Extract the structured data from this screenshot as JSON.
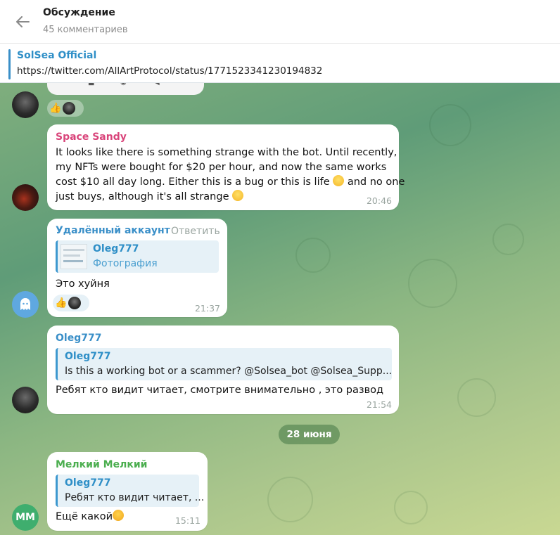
{
  "header": {
    "title": "Обсуждение",
    "subtitle": "45 комментариев"
  },
  "pinned": {
    "name": "SolSea Official",
    "link": "https://twitter.com/AllArtProtocol/status/1771523341230194832"
  },
  "messages": [
    {
      "sender": "Space Sandy",
      "sender_color": "#d9447a",
      "lines": [
        "It looks like there is something strange with the bot. Until recently,",
        "my NFTs were bought for $20 per hour, and now the same works",
        "cost $10 all day long. Either this is a bug or this is life",
        "just buys, although it's all strange"
      ],
      "line3_suffix": "and no one",
      "time": "20:46"
    },
    {
      "sender": "Удалённый аккаунт",
      "sender_color": "#3a8fc8",
      "reply_label": "Ответить",
      "quote_name": "Oleg777",
      "quote_sub": "Фотография",
      "text": "Это хуйня",
      "time": "21:37"
    },
    {
      "sender": "Oleg777",
      "sender_color": "#3a8fc8",
      "quote_name": "Oleg777",
      "quote_text": "Is this a working bot or a scammer? @Solsea_bot @Solsea_Supp...",
      "text": "Ребят кто видит читает, смотрите внимательно , это развод",
      "time": "21:54"
    },
    {
      "sender": "Мелкий Мелкий",
      "sender_color": "#4bae4f",
      "avatar_initials": "ММ",
      "quote_name": "Oleg777",
      "quote_text": "Ребят кто видит читает, ...",
      "text": "Ещё какой",
      "time": "15:11"
    }
  ],
  "date_separator": "28 июня",
  "icons": [
    "back-arrow-icon",
    "thumbs-up-icon",
    "ghost-icon"
  ]
}
